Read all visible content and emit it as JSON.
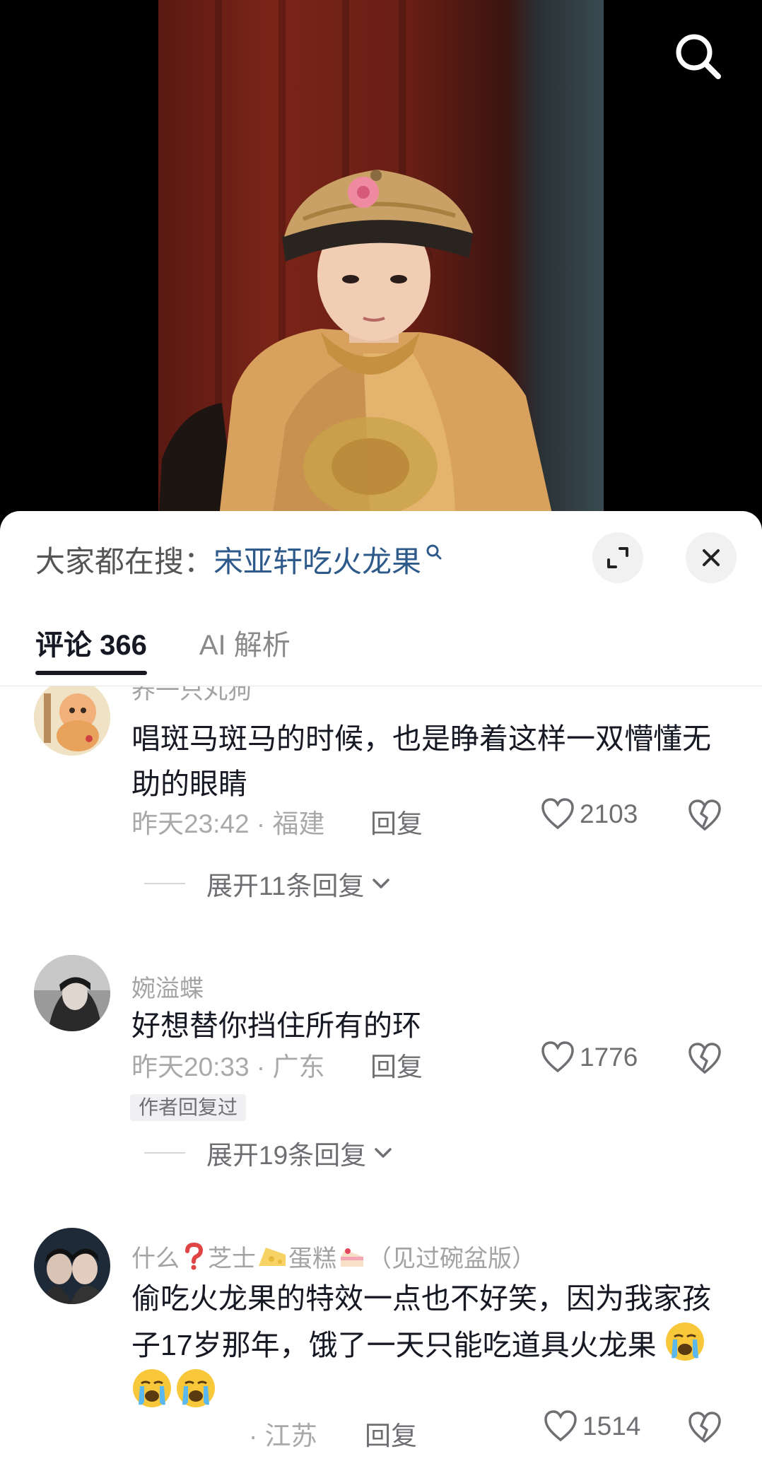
{
  "header": {
    "search_icon": "search-icon"
  },
  "sheet": {
    "trending": {
      "prefix": "大家都在搜：",
      "query": "宋亚轩吃火龙果",
      "query_icon": "search-small-icon"
    },
    "expand_icon": "expand-icon",
    "close_icon": "close-icon",
    "tabs": [
      {
        "label": "评论 366",
        "active": true
      },
      {
        "label": "AI 解析",
        "active": false
      }
    ]
  },
  "comments": [
    {
      "username": "养一只丸狗",
      "text": "唱斑马斑马的时候，也是睁着这样一双懵懂无助的眼睛",
      "time_location": "昨天23:42 · 福建",
      "reply_label": "回复",
      "likes": "2103",
      "author_replied": "",
      "expand_label": "展开11条回复"
    },
    {
      "username": "婉溢蝶",
      "text": "好想替你挡住所有的环",
      "time_location": "昨天20:33 · 广东",
      "reply_label": "回复",
      "likes": "1776",
      "author_replied": "作者回复过",
      "expand_label": "展开19条回复"
    },
    {
      "username_parts": [
        "什么",
        "芝士",
        "蛋糕",
        "（见过碗盆版）"
      ],
      "text": "偷吃火龙果的特效一点也不好笑，因为我家孩子17岁那年，饿了一天只能吃道具火龙果",
      "emojis": [
        "crying-face-emoji",
        "crying-face-emoji",
        "crying-face-emoji"
      ],
      "time_location": "· 江苏",
      "reply_label": "回复",
      "likes": "1514"
    }
  ],
  "colors": {
    "accent_link": "#2d5a8a",
    "text_primary": "#161823",
    "text_secondary": "#a3a3a6"
  }
}
